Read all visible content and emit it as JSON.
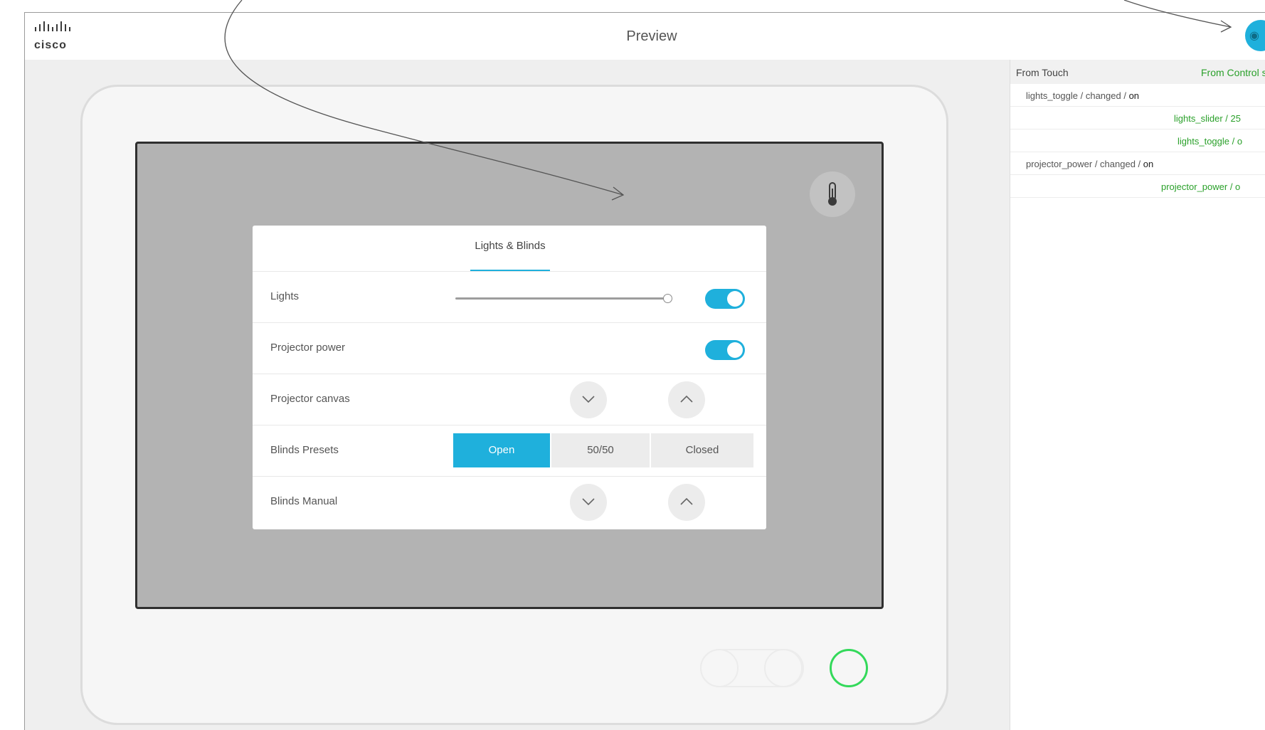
{
  "header": {
    "logo_text": "cisco",
    "title": "Preview",
    "preview_icon": "eye-icon"
  },
  "panel": {
    "tab_label": "Lights & Blinds",
    "rows": [
      {
        "label": "Lights",
        "slider_level": 1.0,
        "toggle_on": true
      },
      {
        "label": "Projector power",
        "toggle_on": true
      },
      {
        "label": "Projector canvas"
      },
      {
        "label": "Blinds Presets",
        "segments": [
          "Open",
          "50/50",
          "Closed"
        ],
        "selected": "Open"
      },
      {
        "label": "Blinds Manual"
      }
    ]
  },
  "log": {
    "col_touch": "From Touch",
    "col_control": "From Control syst",
    "entries": [
      {
        "source": "touch",
        "text": "lights_toggle / changed / ",
        "value": "on"
      },
      {
        "source": "control",
        "text": "lights_slider / 25"
      },
      {
        "source": "control",
        "text": "lights_toggle / o"
      },
      {
        "source": "touch",
        "text": "projector_power / changed / ",
        "value": "on"
      },
      {
        "source": "control",
        "text": "projector_power / o"
      }
    ]
  },
  "colors": {
    "accent": "#1fb0dc",
    "power_led": "#33d95a",
    "control_text": "#2aa02a"
  }
}
